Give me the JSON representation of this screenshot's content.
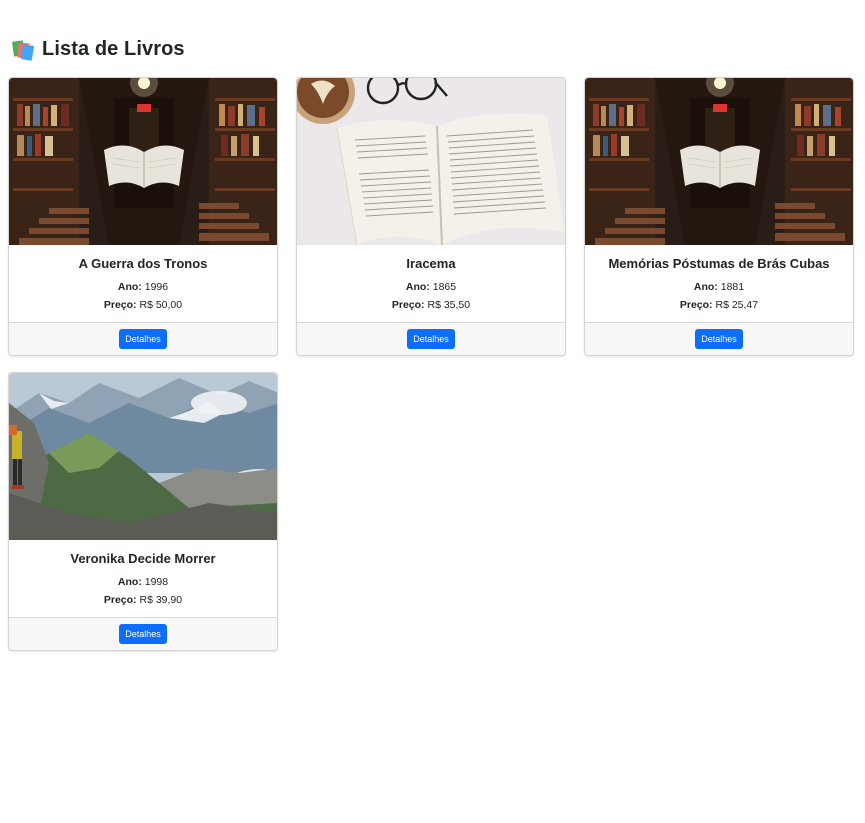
{
  "page": {
    "title": "Lista de Livros",
    "icon": "books-icon"
  },
  "labels": {
    "year": "Ano:",
    "price": "Preço:",
    "details_button": "Detalhes"
  },
  "books": [
    {
      "title": "A Guerra dos Tronos",
      "year": "1996",
      "price": "R$ 50,00",
      "image": "library-floating-book-image"
    },
    {
      "title": "Iracema",
      "year": "1865",
      "price": "R$ 35,50",
      "image": "open-book-coffee-image"
    },
    {
      "title": "Memórias Póstumas de Brás Cubas",
      "year": "1881",
      "price": "R$ 25,47",
      "image": "library-floating-book-image"
    },
    {
      "title": "Veronika Decide Morrer",
      "year": "1998",
      "price": "R$ 39,90",
      "image": "mountain-hiker-image"
    }
  ],
  "colors": {
    "primary_button": "#0d6efd",
    "card_footer": "#f7f7f7"
  }
}
